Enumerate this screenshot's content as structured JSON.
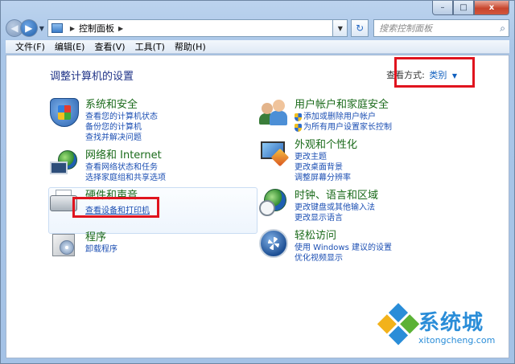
{
  "window": {
    "caption_buttons": {
      "minimize": "–",
      "maximize": "□",
      "close": "x"
    }
  },
  "nav": {
    "back_icon": "back-arrow-icon",
    "forward_icon": "forward-arrow-icon",
    "breadcrumb": [
      "控制面板"
    ],
    "search_placeholder": "搜索控制面板"
  },
  "menu": [
    "文件(F)",
    "编辑(E)",
    "查看(V)",
    "工具(T)",
    "帮助(H)"
  ],
  "page": {
    "title": "调整计算机的设置",
    "view_by_label": "查看方式:",
    "view_by_value": "类别"
  },
  "categories": {
    "security": {
      "title": "系统和安全",
      "links": [
        "查看您的计算机状态",
        "备份您的计算机",
        "查找并解决问题"
      ]
    },
    "network": {
      "title": "网络和 Internet",
      "links": [
        "查看网络状态和任务",
        "选择家庭组和共享选项"
      ]
    },
    "hardware": {
      "title": "硬件和声音",
      "links": [
        "查看设备和打印机"
      ]
    },
    "programs": {
      "title": "程序",
      "links": [
        "卸载程序"
      ]
    },
    "users": {
      "title": "用户帐户和家庭安全",
      "links": [
        "添加或删除用户帐户",
        "为所有用户设置家长控制"
      ]
    },
    "appearance": {
      "title": "外观和个性化",
      "links": [
        "更改主题",
        "更改桌面背景",
        "调整屏幕分辨率"
      ]
    },
    "clock": {
      "title": "时钟、语言和区域",
      "links": [
        "更改键盘或其他输入法",
        "更改显示语言"
      ]
    },
    "ease": {
      "title": "轻松访问",
      "links": [
        "使用 Windows 建议的设置",
        "优化视频显示"
      ]
    }
  },
  "watermark": {
    "text": "系统城",
    "url": "xitongcheng.com"
  },
  "colors": {
    "highlight_box": "#e0141e",
    "link": "#1c4fb3",
    "category_title": "#1a6a1a"
  }
}
